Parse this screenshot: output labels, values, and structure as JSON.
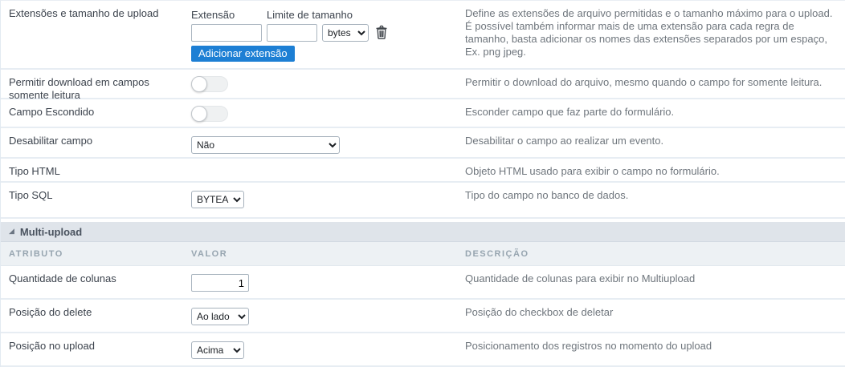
{
  "colors": {
    "button_blue": "#1d7fd4",
    "section_header_bg": "#dfe4ea",
    "table_header_bg": "#edf1f4",
    "row_divider": "#e7edf3"
  },
  "fields": {
    "extensions": {
      "label": "Extensões e tamanho de upload",
      "extensao_label": "Extensão",
      "limite_label": "Limite de tamanho",
      "extensao_value": "",
      "limite_value": "",
      "unit_value": "bytes",
      "add_button": "Adicionar extensão",
      "description": "Define as extensões de arquivo permitidas e o tamanho máximo para o upload. É possível também informar mais de uma extensão para cada regra de tamanho, basta adicionar os nomes das extensões separados por um espaço, Ex. png jpeg."
    },
    "permitir_download": {
      "label": "Permitir download em campos somente leitura",
      "toggle_state": "off",
      "description": "Permitir o download do arquivo, mesmo quando o campo for somente leitura."
    },
    "campo_escondido": {
      "label": "Campo Escondido",
      "toggle_state": "off",
      "description": "Esconder campo que faz parte do formulário."
    },
    "desabilitar_campo": {
      "label": "Desabilitar campo",
      "value": "Não",
      "description": "Desabilitar o campo ao realizar um evento."
    },
    "tipo_html": {
      "label": "Tipo HTML",
      "description": "Objeto HTML usado para exibir o campo no formulário."
    },
    "tipo_sql": {
      "label": "Tipo SQL",
      "value": "BYTEA",
      "description": "Tipo do campo no banco de dados."
    }
  },
  "multi_upload": {
    "section_title": "Multi-upload",
    "columns": [
      "ATRIBUTO",
      "VALOR",
      "DESCRIÇÃO"
    ],
    "rows": [
      {
        "label": "Quantidade de colunas",
        "value": "1",
        "description": "Quantidade de colunas para exibir no Multiupload"
      },
      {
        "label": "Posição do delete",
        "value": "Ao lado",
        "description": "Posição do checkbox de deletar"
      },
      {
        "label": "Posição no upload",
        "value": "Acima",
        "description": "Posicionamento dos registros no momento do upload"
      }
    ]
  }
}
